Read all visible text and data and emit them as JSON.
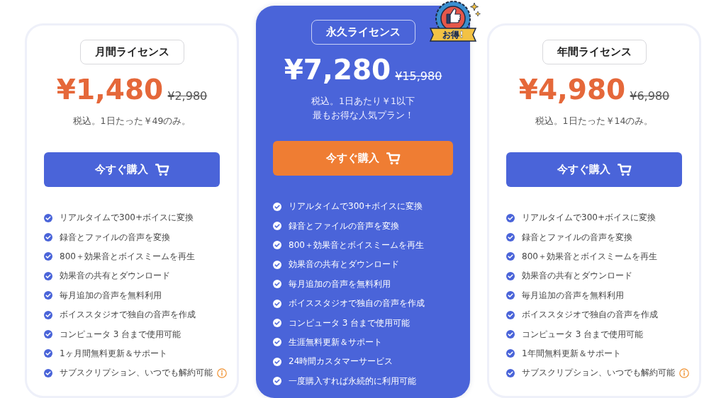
{
  "plans": [
    {
      "name": "月間ライセンス",
      "featured": false,
      "price": "¥1,480",
      "old_price": "¥2,980",
      "notes": [
        "税込。1日たった￥49のみ。"
      ],
      "button": "今すぐ購入",
      "features": [
        {
          "text": "リアルタイムで300+ボイスに変換",
          "info": false
        },
        {
          "text": "録音とファイルの音声を変換",
          "info": false
        },
        {
          "text": "800＋効果音とボイスミームを再生",
          "info": false
        },
        {
          "text": "効果音の共有とダウンロード",
          "info": false
        },
        {
          "text": "毎月追加の音声を無料利用",
          "info": false
        },
        {
          "text": "ボイススタジオで独自の音声を作成",
          "info": false
        },
        {
          "text": "コンピュータ 3 台まで使用可能",
          "info": false
        },
        {
          "text": "1ヶ月間無料更新＆サポート",
          "info": false
        },
        {
          "text": "サブスクリプション、いつでも解約可能",
          "info": true
        }
      ]
    },
    {
      "name": "永久ライセンス",
      "featured": true,
      "badge": "お得!",
      "price": "¥7,280",
      "old_price": "¥15,980",
      "notes": [
        "税込。1日あたり￥1以下",
        "最もお得な人気プラン！"
      ],
      "button": "今すぐ購入",
      "features": [
        {
          "text": "リアルタイムで300+ボイスに変換",
          "info": false
        },
        {
          "text": "録音とファイルの音声を変換",
          "info": false
        },
        {
          "text": "800＋効果音とボイスミームを再生",
          "info": false
        },
        {
          "text": "効果音の共有とダウンロード",
          "info": false
        },
        {
          "text": "毎月追加の音声を無料利用",
          "info": false
        },
        {
          "text": "ボイススタジオで独自の音声を作成",
          "info": false
        },
        {
          "text": "コンピュータ 3 台まで使用可能",
          "info": false
        },
        {
          "text": "生涯無料更新＆サポート",
          "info": false
        },
        {
          "text": "24時間カスタマーサービス",
          "info": false
        },
        {
          "text": "一度購入すれば永続的に利用可能",
          "info": false
        }
      ]
    },
    {
      "name": "年間ライセンス",
      "featured": false,
      "price": "¥4,980",
      "old_price": "¥6,980",
      "notes": [
        "税込。1日たった￥14のみ。"
      ],
      "button": "今すぐ購入",
      "features": [
        {
          "text": "リアルタイムで300+ボイスに変換",
          "info": false
        },
        {
          "text": "録音とファイルの音声を変換",
          "info": false
        },
        {
          "text": "800＋効果音とボイスミームを再生",
          "info": false
        },
        {
          "text": "効果音の共有とダウンロード",
          "info": false
        },
        {
          "text": "毎月追加の音声を無料利用",
          "info": false
        },
        {
          "text": "ボイススタジオで独自の音声を作成",
          "info": false
        },
        {
          "text": "コンピュータ 3 台まで使用可能",
          "info": false
        },
        {
          "text": "1年間無料更新＆サポート",
          "info": false
        },
        {
          "text": "サブスクリプション、いつでも解約可能",
          "info": true
        }
      ]
    }
  ]
}
